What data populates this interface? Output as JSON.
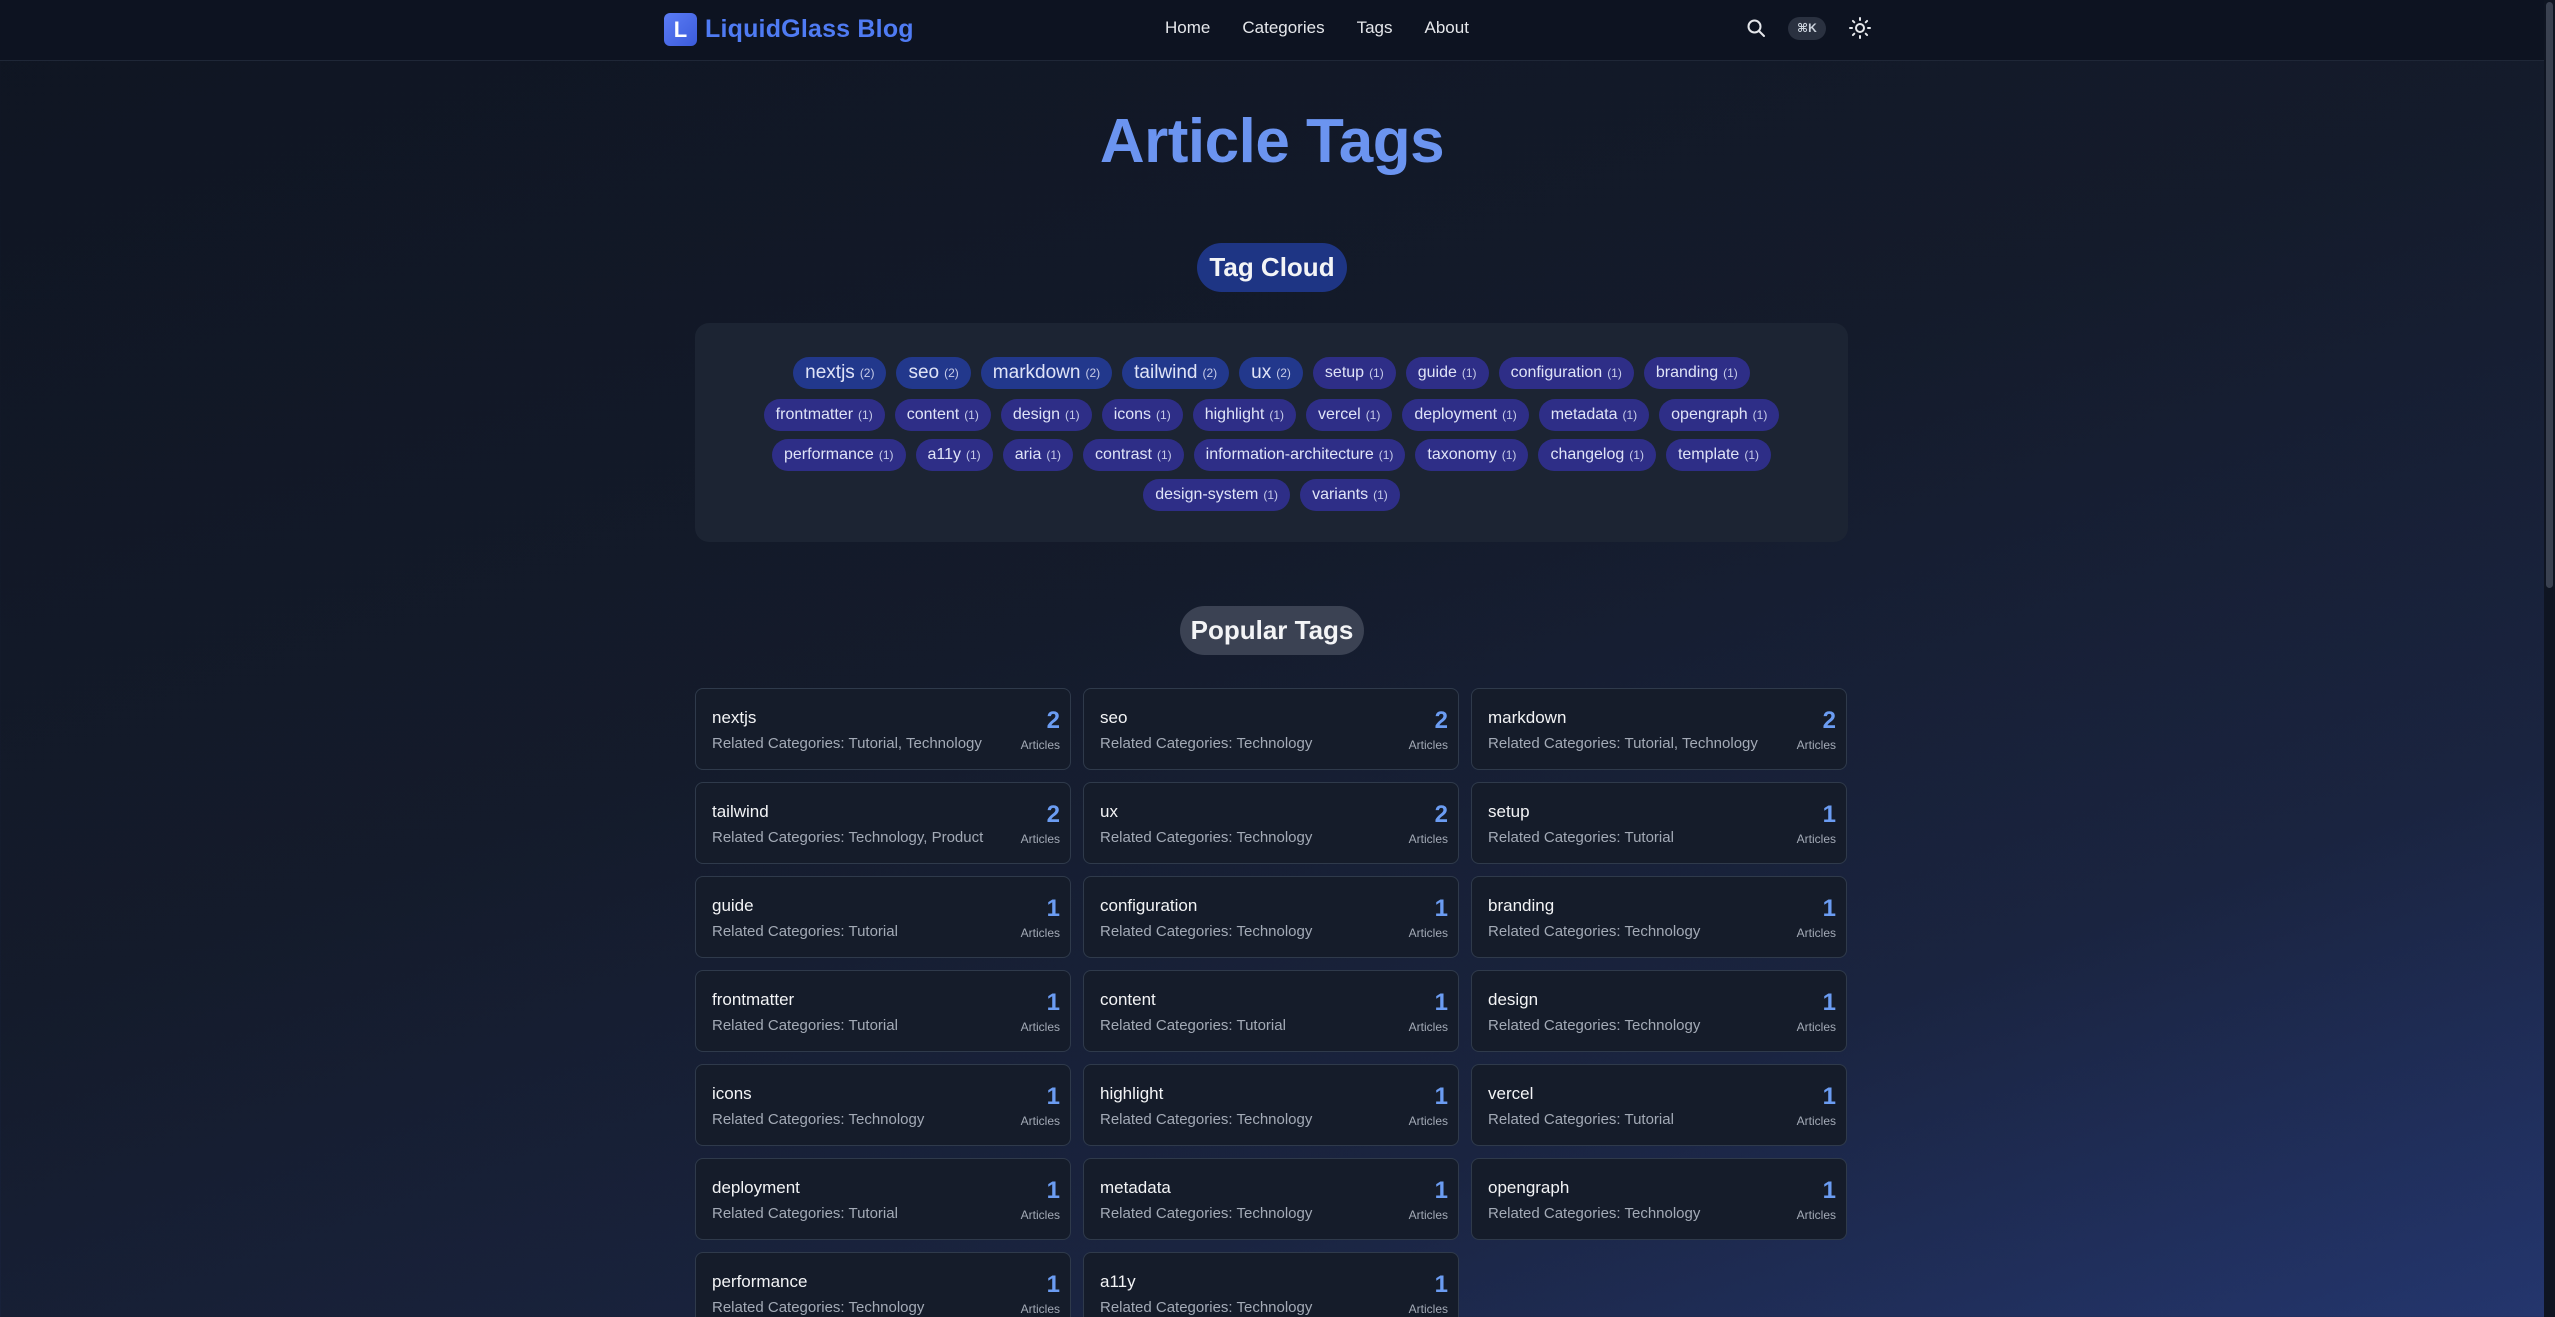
{
  "header": {
    "logo_letter": "L",
    "brand": "LiquidGlass Blog",
    "nav": [
      "Home",
      "Categories",
      "Tags",
      "About"
    ],
    "shortcut": "⌘K"
  },
  "page": {
    "title": "Article Tags",
    "cloud_heading": "Tag Cloud",
    "popular_heading": "Popular Tags"
  },
  "cloud_rows": [
    [
      {
        "name": "nextjs",
        "count": "(2)",
        "big": true
      },
      {
        "name": "seo",
        "count": "(2)",
        "big": true
      },
      {
        "name": "markdown",
        "count": "(2)",
        "big": true
      },
      {
        "name": "tailwind",
        "count": "(2)",
        "big": true
      },
      {
        "name": "ux",
        "count": "(2)",
        "big": true
      },
      {
        "name": "setup",
        "count": "(1)"
      },
      {
        "name": "guide",
        "count": "(1)"
      },
      {
        "name": "configuration",
        "count": "(1)"
      },
      {
        "name": "branding",
        "count": "(1)"
      }
    ],
    [
      {
        "name": "frontmatter",
        "count": "(1)"
      },
      {
        "name": "content",
        "count": "(1)"
      },
      {
        "name": "design",
        "count": "(1)"
      },
      {
        "name": "icons",
        "count": "(1)"
      },
      {
        "name": "highlight",
        "count": "(1)"
      },
      {
        "name": "vercel",
        "count": "(1)"
      },
      {
        "name": "deployment",
        "count": "(1)"
      },
      {
        "name": "metadata",
        "count": "(1)"
      },
      {
        "name": "opengraph",
        "count": "(1)"
      }
    ],
    [
      {
        "name": "performance",
        "count": "(1)"
      },
      {
        "name": "a11y",
        "count": "(1)"
      },
      {
        "name": "aria",
        "count": "(1)"
      },
      {
        "name": "contrast",
        "count": "(1)"
      },
      {
        "name": "information-architecture",
        "count": "(1)"
      },
      {
        "name": "taxonomy",
        "count": "(1)"
      },
      {
        "name": "changelog",
        "count": "(1)"
      },
      {
        "name": "template",
        "count": "(1)"
      }
    ],
    [
      {
        "name": "design-system",
        "count": "(1)"
      },
      {
        "name": "variants",
        "count": "(1)"
      }
    ]
  ],
  "popular_tags": [
    {
      "name": "nextjs",
      "categories": "Related Categories: Tutorial, Technology",
      "count": "2",
      "unit": "Articles"
    },
    {
      "name": "seo",
      "categories": "Related Categories: Technology",
      "count": "2",
      "unit": "Articles"
    },
    {
      "name": "markdown",
      "categories": "Related Categories: Tutorial, Technology",
      "count": "2",
      "unit": "Articles"
    },
    {
      "name": "tailwind",
      "categories": "Related Categories: Technology, Product",
      "count": "2",
      "unit": "Articles"
    },
    {
      "name": "ux",
      "categories": "Related Categories: Technology",
      "count": "2",
      "unit": "Articles"
    },
    {
      "name": "setup",
      "categories": "Related Categories: Tutorial",
      "count": "1",
      "unit": "Articles"
    },
    {
      "name": "guide",
      "categories": "Related Categories: Tutorial",
      "count": "1",
      "unit": "Articles"
    },
    {
      "name": "configuration",
      "categories": "Related Categories: Technology",
      "count": "1",
      "unit": "Articles"
    },
    {
      "name": "branding",
      "categories": "Related Categories: Technology",
      "count": "1",
      "unit": "Articles"
    },
    {
      "name": "frontmatter",
      "categories": "Related Categories: Tutorial",
      "count": "1",
      "unit": "Articles"
    },
    {
      "name": "content",
      "categories": "Related Categories: Tutorial",
      "count": "1",
      "unit": "Articles"
    },
    {
      "name": "design",
      "categories": "Related Categories: Technology",
      "count": "1",
      "unit": "Articles"
    },
    {
      "name": "icons",
      "categories": "Related Categories: Technology",
      "count": "1",
      "unit": "Articles"
    },
    {
      "name": "highlight",
      "categories": "Related Categories: Technology",
      "count": "1",
      "unit": "Articles"
    },
    {
      "name": "vercel",
      "categories": "Related Categories: Tutorial",
      "count": "1",
      "unit": "Articles"
    },
    {
      "name": "deployment",
      "categories": "Related Categories: Tutorial",
      "count": "1",
      "unit": "Articles"
    },
    {
      "name": "metadata",
      "categories": "Related Categories: Technology",
      "count": "1",
      "unit": "Articles"
    },
    {
      "name": "opengraph",
      "categories": "Related Categories: Technology",
      "count": "1",
      "unit": "Articles"
    },
    {
      "name": "performance",
      "categories": "Related Categories: Technology",
      "count": "1",
      "unit": "Articles"
    },
    {
      "name": "a11y",
      "categories": "Related Categories: Technology",
      "count": "1",
      "unit": "Articles"
    }
  ],
  "icons": {
    "search": "search-icon",
    "theme": "sun-icon"
  }
}
